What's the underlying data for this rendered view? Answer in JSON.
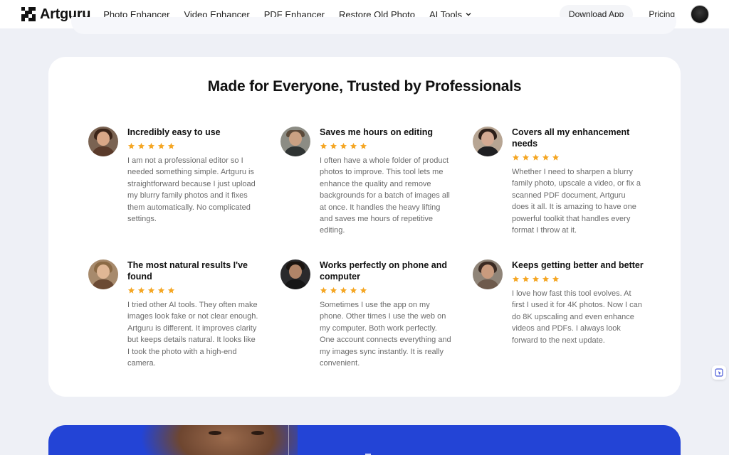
{
  "brand": {
    "name": "Artguru"
  },
  "nav": {
    "items": [
      {
        "label": "Photo Enhancer"
      },
      {
        "label": "Video Enhancer"
      },
      {
        "label": "PDF Enhancer"
      },
      {
        "label": "Restore Old Photo"
      },
      {
        "label": "AI Tools"
      }
    ],
    "download_label": "Download App",
    "pricing_label": "Pricing"
  },
  "testimonials": {
    "title": "Made for Everyone, Trusted by Professionals",
    "rating_color": "#f5a623",
    "reviews": [
      {
        "title": "Incredibly easy to use",
        "stars": 5,
        "text": "I am not a professional editor so I needed something simple. Artguru is straightforward because I just upload my blurry family photos and it fixes them automatically. No complicated settings."
      },
      {
        "title": "Saves me hours on editing",
        "stars": 5,
        "text": "I often have a whole folder of product photos to improve. This tool lets me enhance the quality and remove backgrounds for a batch of images all at once. It handles the heavy lifting and saves me hours of repetitive editing."
      },
      {
        "title": "Covers all my enhancement needs",
        "stars": 5,
        "text": "Whether I need to sharpen a blurry family photo, upscale a video, or fix a scanned PDF document, Artguru does it all. It is amazing to have one powerful toolkit that handles every format I throw at it."
      },
      {
        "title": "The most natural results I've found",
        "stars": 5,
        "text": "I tried other AI tools. They often make images look fake or not clear enough. Artguru is different. It improves clarity but keeps details natural. It looks like I took the photo with a high-end camera."
      },
      {
        "title": "Works perfectly on phone and computer",
        "stars": 5,
        "text": "Sometimes I use the app on my phone. Other times I use the web on my computer. Both work perfectly. One account connects everything and my images sync instantly. It is really convenient."
      },
      {
        "title": "Keeps getting better and better",
        "stars": 5,
        "text": "I love how fast this tool evolves. At first I used it for 4K photos. Now I can do 8K upscaling and even enhance videos and PDFs. I always look forward to the next update."
      }
    ]
  },
  "colors": {
    "page_bg": "#eef0f6",
    "banner_blue": "#2344d6"
  }
}
